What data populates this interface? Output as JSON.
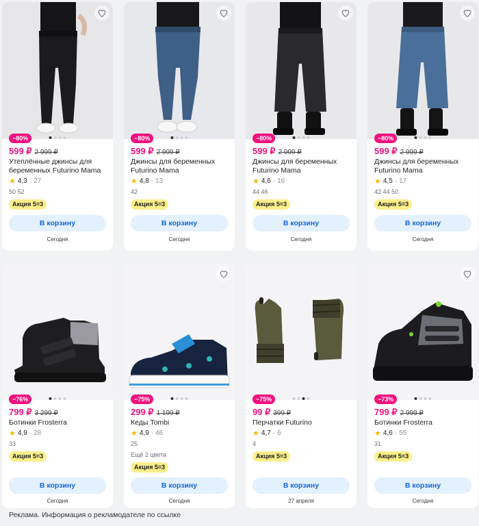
{
  "products": [
    {
      "discount": "−80%",
      "price": "599 ₽",
      "old_price": "2 999 ₽",
      "title": "Утеплённые джинсы для беременных Futurino Mama",
      "rating": "4,3",
      "reviews": "27",
      "sizes": "50  52",
      "promo": "Акция 5=3",
      "button": "В корзину",
      "delivery": "Сегодня",
      "image": "black-maternity-jeans",
      "colors": ""
    },
    {
      "discount": "−80%",
      "price": "599 ₽",
      "old_price": "2 999 ₽",
      "title": "Джинсы для беременных Futurino Mama",
      "rating": "4,8",
      "reviews": "13",
      "sizes": "42",
      "promo": "Акция 5=3",
      "button": "В корзину",
      "delivery": "Сегодня",
      "image": "blue-maternity-jeans",
      "colors": ""
    },
    {
      "discount": "−80%",
      "price": "599 ₽",
      "old_price": "2 999 ₽",
      "title": "Джинсы для беременных Futurino Mama",
      "rating": "4,6",
      "reviews": "16",
      "sizes": "44  46",
      "promo": "Акция 5=3",
      "button": "В корзину",
      "delivery": "Сегодня",
      "image": "black-wide-jeans",
      "colors": ""
    },
    {
      "discount": "−80%",
      "price": "599 ₽",
      "old_price": "2 999 ₽",
      "title": "Джинсы для беременных Futurino Mama",
      "rating": "4,5",
      "reviews": "17",
      "sizes": "42  44  50",
      "promo": "Акция 5=3",
      "button": "В корзину",
      "delivery": "Сегодня",
      "image": "blue-wide-jeans",
      "colors": ""
    },
    {
      "discount": "−76%",
      "price": "799 ₽",
      "old_price": "3 299 ₽",
      "title": "Ботинки Frosterra",
      "rating": "4,9",
      "reviews": "28",
      "sizes": "33",
      "promo": "Акция 5=3",
      "button": "В корзину",
      "delivery": "Сегодня",
      "image": "black-boots",
      "colors": ""
    },
    {
      "discount": "−75%",
      "price": "299 ₽",
      "old_price": "1 199 ₽",
      "title": "Кеды Tombi",
      "rating": "4,9",
      "reviews": "46",
      "sizes": "25",
      "promo": "Акция 5=3",
      "button": "В корзину",
      "delivery": "Сегодня",
      "image": "kids-sneakers",
      "colors": "Ещё 2 цвета"
    },
    {
      "discount": "−75%",
      "price": "99 ₽",
      "old_price": "399 ₽",
      "title": "Перчатки Futurino",
      "rating": "4,7",
      "reviews": "6",
      "sizes": "4",
      "promo": "Акция 5=3",
      "button": "В корзину",
      "delivery": "27 апреля",
      "image": "gloves",
      "colors": ""
    },
    {
      "discount": "−73%",
      "price": "799 ₽",
      "old_price": "2 999 ₽",
      "title": "Ботинки Frosterra",
      "rating": "4,6",
      "reviews": "55",
      "sizes": "31",
      "promo": "Акция 5=3",
      "button": "В корзину",
      "delivery": "Сегодня",
      "image": "winter-boots",
      "colors": ""
    }
  ],
  "footer": {
    "ad_note": "Реклама. Информация о рекламодателе по ссылке"
  },
  "icons": {
    "favorite": "heart-outline-icon",
    "rating": "star-icon"
  },
  "colors": {
    "price": "#f1117e",
    "discount_badge": "#f1117e",
    "promo_badge": "#fbef8a",
    "button_bg": "#e3f0fd",
    "button_text": "#1565d8",
    "star": "#f8b808"
  }
}
